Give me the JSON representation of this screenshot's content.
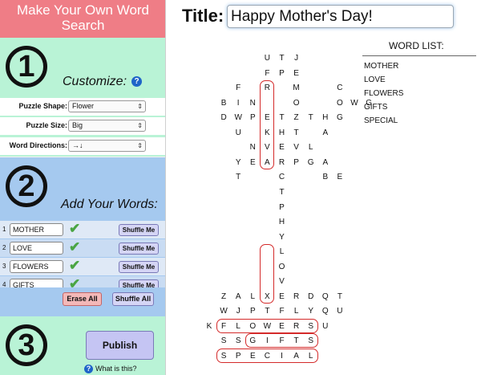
{
  "sidebar": {
    "header": [
      "Make Your Own Word",
      "Search"
    ],
    "step1": {
      "number": "1",
      "heading": "Customize:",
      "help_icon": "?",
      "options": [
        {
          "label": "Puzzle Shape:",
          "value": "Flower"
        },
        {
          "label": "Puzzle Size:",
          "value": "Big"
        },
        {
          "label": "Word Directions:",
          "value": "→↓"
        }
      ]
    },
    "step2": {
      "number": "2",
      "heading": "Add Your Words:",
      "words": [
        {
          "num": "1",
          "value": "MOTHER",
          "shuffle": "Shuffle Me"
        },
        {
          "num": "2",
          "value": "LOVE",
          "shuffle": "Shuffle Me"
        },
        {
          "num": "3",
          "value": "FLOWERS",
          "shuffle": "Shuffle Me"
        },
        {
          "num": "4",
          "value": "GIFTS",
          "shuffle": "Shuffle Me"
        }
      ],
      "erase_all": "Erase All",
      "shuffle_all": "Shuffle All"
    },
    "step3": {
      "number": "3",
      "publish": "Publish",
      "help_icon": "?",
      "what_is_this": "What is this?"
    }
  },
  "main": {
    "title_label": "Title:",
    "title_value": "Happy Mother's Day!",
    "word_list_title": "WORD LIST:",
    "word_list": [
      "MOTHER",
      "LOVE",
      "FLOWERS",
      "GIFTS",
      "SPECIAL"
    ],
    "puzzle_rows": [
      {
        "text": "UTJ",
        "start": 4
      },
      {
        "text": "FPE",
        "start": 4
      },
      {
        "text": "F R M  C",
        "start": 2
      },
      {
        "text": "BIN  O  OWG",
        "start": 1
      },
      {
        "text": "DWPETZTHG",
        "start": 1
      },
      {
        "text": "U KHT A",
        "start": 2
      },
      {
        "text": "NVEVL",
        "start": 3
      },
      {
        "text": "YEARPGA",
        "start": 2
      },
      {
        "text": "T  C  BE",
        "start": 2
      },
      {
        "text": "T",
        "start": 5
      },
      {
        "text": "P",
        "start": 5
      },
      {
        "text": "H",
        "start": 5
      },
      {
        "text": "Y",
        "start": 5
      },
      {
        "text": "L",
        "start": 5
      },
      {
        "text": "O",
        "start": 5
      },
      {
        "text": "V",
        "start": 5
      },
      {
        "text": "ZALXERDQT",
        "start": 1
      },
      {
        "text": "WJPTFLYQU",
        "start": 1
      },
      {
        "text": "KFLOWERSU",
        "start": 0
      },
      {
        "text": "SSGIFTS",
        "start": 1
      },
      {
        "text": "SPECIAL",
        "start": 1
      }
    ]
  },
  "colors": {
    "header": "#ef7d86",
    "section_green": "#b9f3d6",
    "section_blue": "#a5c9ef",
    "check": "#4aa543",
    "highlight": "#d42a2a"
  }
}
